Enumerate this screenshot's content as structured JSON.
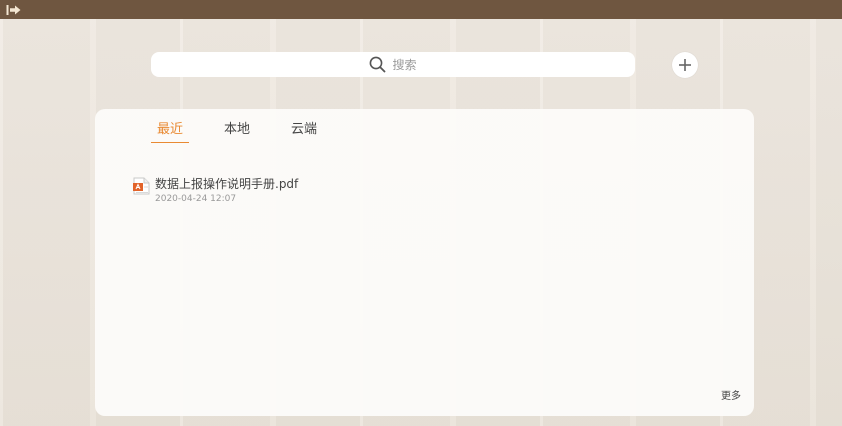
{
  "topbar": {
    "color": "#6f5640"
  },
  "search": {
    "placeholder": "搜索"
  },
  "tabs": [
    {
      "label": "最近",
      "active": true
    },
    {
      "label": "本地",
      "active": false
    },
    {
      "label": "云端",
      "active": false
    }
  ],
  "recent_files": [
    {
      "name": "数据上报操作说明手册.pdf",
      "time": "2020-04-24 12:07",
      "icon": "pdf-file-icon"
    }
  ],
  "more_label": "更多",
  "colors": {
    "accent": "#e98a33",
    "pdf_icon": "#e2632a"
  }
}
